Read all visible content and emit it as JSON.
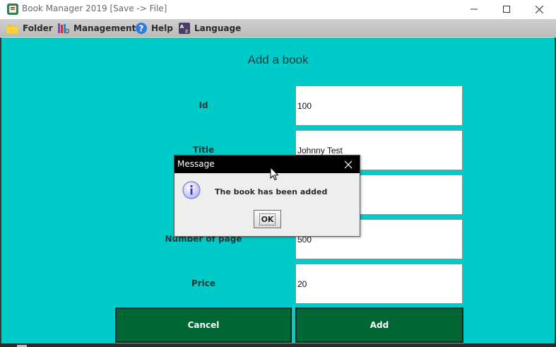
{
  "window": {
    "title": "Book Manager 2019 [Save -> File]",
    "icon": "book-app-icon",
    "controls": [
      "minimize-icon",
      "maximize-icon",
      "close-icon"
    ]
  },
  "menu": {
    "items": [
      {
        "label": "Folder",
        "icon": "folder-icon"
      },
      {
        "label": "Management",
        "icon": "management-icon"
      },
      {
        "label": "Help",
        "icon": "help-icon"
      },
      {
        "label": "Language",
        "icon": "language-icon"
      }
    ]
  },
  "form": {
    "title": "Add a book",
    "fields": {
      "id": {
        "label": "Id",
        "value": "100"
      },
      "title": {
        "label": "Title",
        "value": "Johnny Test"
      },
      "author": {
        "label": "",
        "value": ""
      },
      "pages": {
        "label": "Number of page",
        "value": "500"
      },
      "price": {
        "label": "Price",
        "value": "20"
      }
    },
    "buttons": {
      "cancel": "Cancel",
      "add": "Add"
    }
  },
  "dialog": {
    "title": "Message",
    "message": "The book has been added",
    "ok_label": "OK",
    "icon": "info-icon"
  },
  "colors": {
    "panel_bg": "#00cbc9",
    "button_bg": "#006633",
    "dialog_titlebar": "#000000"
  }
}
